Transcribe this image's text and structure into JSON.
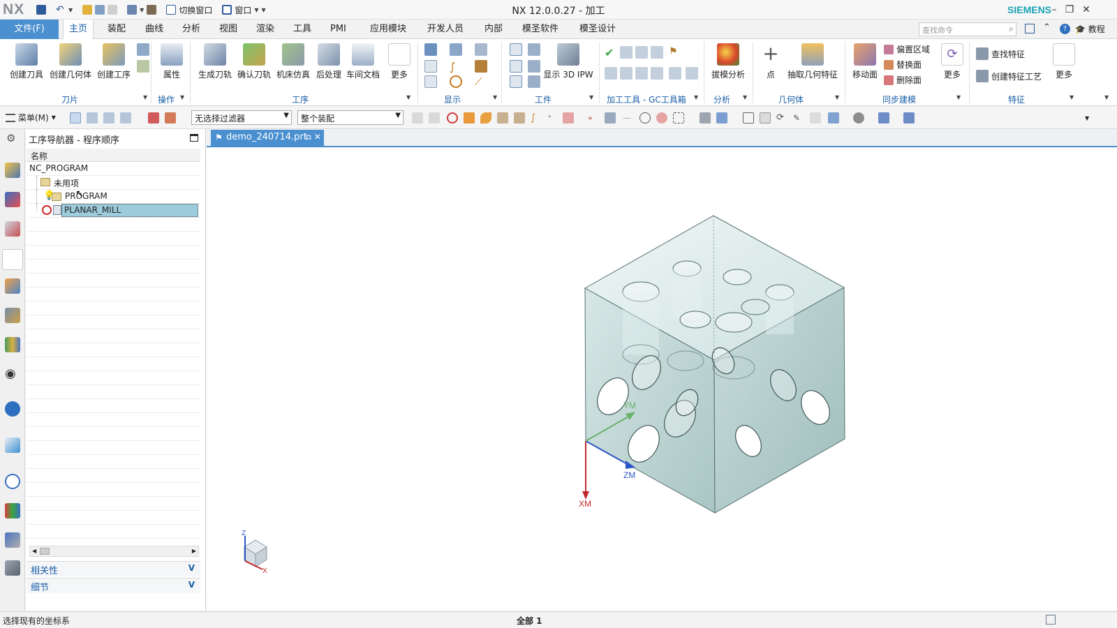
{
  "window": {
    "logo": "NX",
    "title": "NX 12.0.0.27 - 加工",
    "brand": "SIEMENS",
    "switch_window": "切换窗口",
    "window_menu": "窗口"
  },
  "menubar": {
    "file": "文件(F)",
    "tabs": [
      "主页",
      "装配",
      "曲线",
      "分析",
      "视图",
      "渲染",
      "工具",
      "PMI",
      "应用模块",
      "开发人员",
      "内部",
      "模圣软件",
      "模圣设计"
    ],
    "active_tab": "主页",
    "search_placeholder": "查找命令",
    "help": "教程"
  },
  "ribbon": {
    "create_tool": "创建刀具",
    "create_geometry": "创建几何体",
    "create_operation": "创建工序",
    "properties": "属性",
    "generate_path": "生成刀轨",
    "verify_path": "确认刀轨",
    "machine_sim": "机床仿真",
    "post_process": "后处理",
    "shop_doc": "车间文档",
    "more": "更多",
    "show_3d_ipw": "显示 3D IPW",
    "draft_analysis": "拔模分析",
    "point": "点",
    "extract_geometry": "抽取几何特征",
    "move_face": "移动面",
    "offset_region": "偏置区域",
    "replace_face": "替换面",
    "delete_face": "删除面",
    "find_feature": "查找特征",
    "create_feature_process": "创建特征工艺",
    "groups": {
      "tool": "刀片",
      "ops": "操作",
      "procedure": "工序",
      "display": "显示",
      "workpiece": "工件",
      "gc_toolbox": "加工工具 - GC工具箱",
      "analysis": "分析",
      "geometry": "几何体",
      "sync_model": "同步建模",
      "feature": "特征"
    }
  },
  "toolbar": {
    "menu": "菜单(M)",
    "filter": "无选择过滤器",
    "assembly": "整个装配"
  },
  "navigator": {
    "title": "工序导航器 - 程序顺序",
    "column_name": "名称",
    "rows": [
      "NC_PROGRAM",
      "未用项",
      "PROGRAM",
      "PLANAR_MILL"
    ],
    "selected": "PLANAR_MILL",
    "accordion": [
      "相关性",
      "细节"
    ]
  },
  "document": {
    "tab": "demo_240714.prt"
  },
  "viewport": {
    "axes": {
      "x": "XM",
      "y": "YM",
      "z": "ZM"
    },
    "triad": {
      "x": "X",
      "z": "Z"
    },
    "colors": {
      "body_front": "#c9dedd",
      "body_top": "#dcebea",
      "body_side": "#b9d2d1",
      "edge": "#4a5d5c",
      "axis_x": "#c0282a",
      "axis_y": "#6ab26a",
      "axis_z": "#2a55c4"
    }
  },
  "status": {
    "prompt": "选择现有的坐标系",
    "center": "全部 1"
  }
}
